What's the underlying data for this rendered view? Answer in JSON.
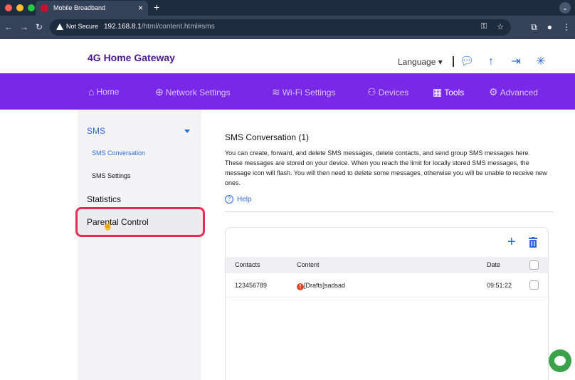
{
  "browser": {
    "tab_title": "Mobile Broadband",
    "not_secure": "Not Secure",
    "url_host": "192.168.8.1",
    "url_path": "/html/content.html#sms"
  },
  "header": {
    "brand": "4G Home Gateway",
    "language": "Language"
  },
  "menu": [
    {
      "label": "Home",
      "icon": "home-icon"
    },
    {
      "label": "Network Settings",
      "icon": "globe-icon"
    },
    {
      "label": "Wi-Fi Settings",
      "icon": "wifi-icon"
    },
    {
      "label": "Devices",
      "icon": "devices-icon"
    },
    {
      "label": "Tools",
      "icon": "tools-icon"
    },
    {
      "label": "Advanced",
      "icon": "gear-icon"
    }
  ],
  "sidebar": {
    "sms": "SMS",
    "sms_conversation": "SMS Conversation",
    "sms_settings": "SMS Settings",
    "statistics": "Statistics",
    "parental_control": "Parental Control"
  },
  "main": {
    "title": "SMS Conversation (1)",
    "description": "You can create, forward, and delete SMS messages, delete contacts, and send group SMS messages here. These messages are stored on your device. When you reach the limit for locally stored SMS messages, the message icon will flash. You will then need to delete some messages, otherwise you will be unable to receive new ones.",
    "help": "Help"
  },
  "table": {
    "columns": [
      "Contacts",
      "Content",
      "Date"
    ],
    "rows": [
      {
        "contact": "123456789",
        "content": "[Drafts]sadsad",
        "date": "09:51:22"
      }
    ]
  },
  "colors": {
    "accent": "#7a28e8",
    "brand": "#4a1a8a",
    "link": "#2c6ad6",
    "highlight": "#e0305a"
  }
}
